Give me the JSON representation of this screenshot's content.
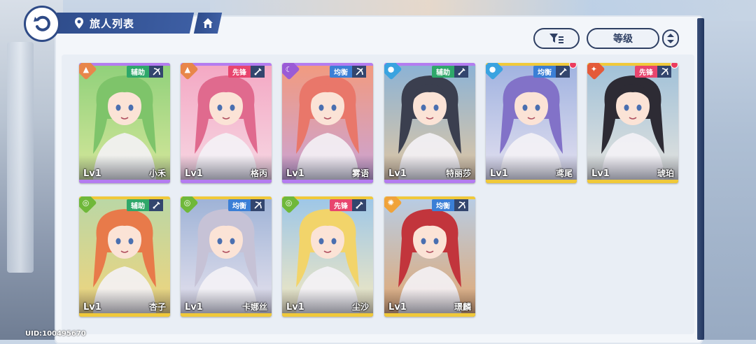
{
  "header": {
    "title": "旅人列表",
    "back_icon": "back-arrow-icon",
    "location_icon": "map-pin-icon",
    "home_icon": "home-icon"
  },
  "controls": {
    "filter_icon": "filter-icon",
    "sort_label": "等级",
    "order_icon": "sort-order-icon"
  },
  "colors": {
    "primary_navy": "#2f4d8c",
    "role_support": "#2fa86a",
    "role_vanguard": "#e8456e",
    "role_balanced": "#3b7fd6",
    "notification": "#ec3b5d"
  },
  "characters": [
    {
      "name": "小禾",
      "level": "Lv1",
      "role": "辅助",
      "element": "mountain",
      "weapon": "bow",
      "alert": false,
      "accent": "#7ec46a",
      "bg": [
        "#8fd07a",
        "#d8e89c"
      ],
      "bar": "#b47cf0"
    },
    {
      "name": "格丙",
      "level": "Lv1",
      "role": "先锋",
      "element": "mountain",
      "weapon": "sword",
      "alert": false,
      "accent": "#e06a8e",
      "bg": [
        "#f4a7c3",
        "#f6d9e4"
      ],
      "bar": "#b47cf0"
    },
    {
      "name": "雾语",
      "level": "Lv1",
      "role": "均衡",
      "element": "moon",
      "weapon": "bow",
      "alert": false,
      "accent": "#e9776a",
      "bg": [
        "#f29a7e",
        "#c9a4d8"
      ],
      "bar": "#b47cf0"
    },
    {
      "name": "特丽莎",
      "level": "Lv1",
      "role": "辅助",
      "element": "water",
      "weapon": "sword",
      "alert": false,
      "accent": "#3b3f4f",
      "bg": [
        "#8ab2d6",
        "#e3c8a2"
      ],
      "bar": "#b47cf0"
    },
    {
      "name": "鸢尾",
      "level": "Lv1",
      "role": "均衡",
      "element": "water",
      "weapon": "sword",
      "alert": true,
      "accent": "#8272c8",
      "bg": [
        "#9fb2e0",
        "#e6e2f0"
      ],
      "bar": "#f0c93a"
    },
    {
      "name": "琥珀",
      "level": "Lv1",
      "role": "先锋",
      "element": "fire",
      "weapon": "bow",
      "alert": true,
      "accent": "#2d2b34",
      "bg": [
        "#9fc0d8",
        "#e7e5df"
      ],
      "bar": "#f0c93a"
    },
    {
      "name": "杏子",
      "level": "Lv1",
      "role": "辅助",
      "element": "wind",
      "weapon": "sword",
      "alert": false,
      "accent": "#e87a4a",
      "bg": [
        "#b9d7a6",
        "#f3d47a"
      ],
      "bar": "#f0c93a"
    },
    {
      "name": "卡娜丝",
      "level": "Lv1",
      "role": "均衡",
      "element": "wind",
      "weapon": "bow",
      "alert": false,
      "accent": "#c6c2d6",
      "bg": [
        "#9db2d6",
        "#e9e4ef"
      ],
      "bar": "#f0c93a"
    },
    {
      "name": "尘沙",
      "level": "Lv1",
      "role": "先锋",
      "element": "wind",
      "weapon": "sword",
      "alert": false,
      "accent": "#f2d46a",
      "bg": [
        "#9cc6e8",
        "#f6eac0"
      ],
      "bar": "#f0c93a"
    },
    {
      "name": "璟麟",
      "level": "Lv1",
      "role": "均衡",
      "element": "sun",
      "weapon": "bow",
      "alert": false,
      "accent": "#c2353c",
      "bg": [
        "#b7cde6",
        "#e3a76f"
      ],
      "bar": "#f0c93a"
    }
  ],
  "footer": {
    "uid": "UID:100495670"
  }
}
